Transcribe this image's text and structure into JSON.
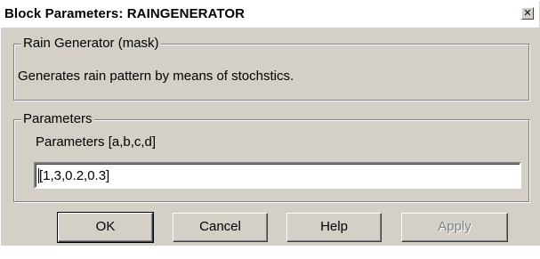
{
  "window": {
    "title": "Block Parameters: RAINGENERATOR",
    "close_glyph": "✕"
  },
  "mask_group": {
    "legend": "Rain Generator (mask)",
    "description": "Generates rain pattern by means of stochstics."
  },
  "params_group": {
    "legend": "Parameters",
    "field_label": "Parameters [a,b,c,d]",
    "field_value": "[1,3,0.2,0.3]"
  },
  "buttons": {
    "ok": "OK",
    "cancel": "Cancel",
    "help": "Help",
    "apply": "Apply"
  }
}
